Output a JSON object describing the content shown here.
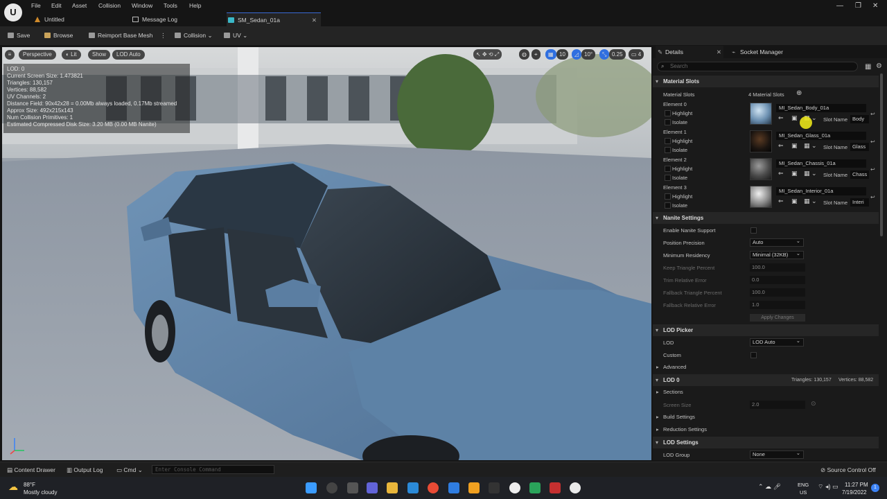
{
  "menu": [
    "File",
    "Edit",
    "Asset",
    "Collision",
    "Window",
    "Tools",
    "Help"
  ],
  "tabs": [
    {
      "label": "Untitled"
    },
    {
      "label": "Message Log"
    },
    {
      "label": "SM_Sedan_01a"
    }
  ],
  "toolbar": {
    "save": "Save",
    "browse": "Browse",
    "reimport": "Reimport Base Mesh",
    "collision": "Collision",
    "uv": "UV"
  },
  "viewport": {
    "perspective": "Perspective",
    "lit": "Lit",
    "show": "Show",
    "lod": "LOD Auto",
    "grid_value": "10",
    "angle_value": "10°",
    "scale_value": "0.25",
    "cam_value": "4",
    "stats": [
      "LOD:  0",
      "Current Screen Size:  1.473821",
      "Triangles:  130,157",
      "Vertices:  88,582",
      "UV Channels:  2",
      "Distance Field:  90x42x28 = 0.00Mb always loaded, 0.17Mb streamed",
      "Approx Size: 492x215x143",
      "Num Collision Primitives:  1",
      "Estimated Compressed Disk Size: 3.20 MB (0.00 MB Nanite)"
    ]
  },
  "details": {
    "tab_details": "Details",
    "tab_socket": "Socket Manager",
    "search_placeholder": "Search",
    "material_slots": {
      "header": "Material Slots",
      "label": "Material Slots",
      "count": "4 Material Slots",
      "highlight": "Highlight",
      "isolate": "Isolate",
      "slot_name_label": "Slot Name",
      "elements": [
        {
          "element": "Element 0",
          "material": "MI_Sedan_Body_01a",
          "slot": "Body"
        },
        {
          "element": "Element 1",
          "material": "MI_Sedan_Glass_01a",
          "slot": "Glass"
        },
        {
          "element": "Element 2",
          "material": "MI_Sedan_Chassis_01a",
          "slot": "Chass"
        },
        {
          "element": "Element 3",
          "material": "MI_Sedan_Interior_01a",
          "slot": "Interi"
        }
      ]
    },
    "nanite": {
      "header": "Nanite Settings",
      "enable": "Enable Nanite Support",
      "position_precision": "Position Precision",
      "position_precision_value": "Auto",
      "min_residency": "Minimum Residency",
      "min_residency_value": "Minimal (32KB)",
      "keep_tri": "Keep Triangle Percent",
      "keep_tri_value": "100.0",
      "trim_err": "Trim Relative Error",
      "trim_err_value": "0.0",
      "fallback_tri": "Fallback Triangle Percent",
      "fallback_tri_value": "100.0",
      "fallback_err": "Fallback Relative Error",
      "fallback_err_value": "1.0",
      "apply": "Apply Changes"
    },
    "lod_picker": {
      "header": "LOD Picker",
      "lod": "LOD",
      "lod_value": "LOD Auto",
      "custom": "Custom",
      "advanced": "Advanced"
    },
    "lod0": {
      "header": "LOD 0",
      "triangles": "Triangles: 130,157",
      "vertices": "Vertices: 88,582",
      "sections": "Sections",
      "screen_size": "Screen Size",
      "screen_size_value": "2.0",
      "build": "Build Settings",
      "reduction": "Reduction Settings"
    },
    "lod_settings": {
      "header": "LOD Settings",
      "group": "LOD Group",
      "group_value": "None"
    }
  },
  "bottom": {
    "drawer": "Content Drawer",
    "output": "Output Log",
    "cmd": "Cmd",
    "console_placeholder": "Enter Console Command",
    "source": "Source Control Off"
  },
  "taskbar": {
    "temp": "88°F",
    "weather": "Mostly cloudy",
    "lang1": "ENG",
    "lang2": "US",
    "time": "11:27 PM",
    "date": "7/19/2022",
    "notif": "1"
  },
  "colors": {
    "accent": "#2f6fe0",
    "highlight_marker": "#e9e31a",
    "panel": "#1a1a1a"
  }
}
